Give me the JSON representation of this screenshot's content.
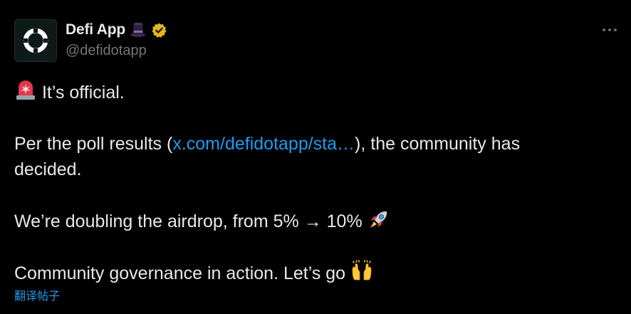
{
  "author": {
    "display_name": "Defi App",
    "handle": "@defidotapp",
    "avatar_icon": "defi-app-logo-icon",
    "name_emoji": "top-hat-icon",
    "verified_badge": "gold-verified-badge-icon"
  },
  "menu": {
    "icon": "more-horizontal-icon"
  },
  "post": {
    "line1_icon": "police-light-icon",
    "line1_text": " It’s official.",
    "line2_before": "Per the poll results (",
    "line2_link": "x.com/defidotapp/sta…",
    "line2_after": "), the community has",
    "line3": "decided.",
    "line4_text": "We’re doubling the airdrop, from 5% → 10% ",
    "line4_icon": "rocket-icon",
    "line5_text": "Community governance in action. Let’s go ",
    "line5_icon": "raising-hands-icon"
  },
  "translate_label": "翻译帖子",
  "colors": {
    "background": "#000000",
    "text": "#e7e9ea",
    "secondary": "#71767b",
    "link": "#1d9bf0",
    "verified": "#e2b719"
  }
}
